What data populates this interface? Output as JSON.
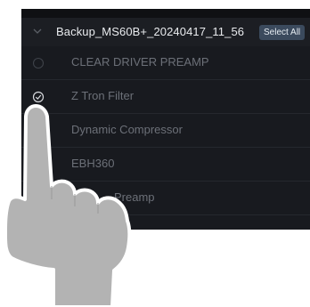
{
  "group": {
    "title": "Backup_MS60B+_20240417_11_56",
    "select_all_label": "Select All",
    "expand_icon": "chevron-down-icon"
  },
  "items": [
    {
      "label": "CLEAR DRIVER PREAMP",
      "checked": false
    },
    {
      "label": "Z Tron Filter",
      "checked": true
    },
    {
      "label": "Dynamic Compressor",
      "checked": false
    },
    {
      "label": "EBH360",
      "checked": false
    },
    {
      "label": "Preamp",
      "checked": false
    }
  ],
  "colors": {
    "panel_bg": "#181a1f",
    "header_bg": "#1c1e23",
    "badge_bg": "#3b4a5d",
    "hand_fill": "#b3b3b3",
    "hand_stroke": "#ffffff"
  }
}
